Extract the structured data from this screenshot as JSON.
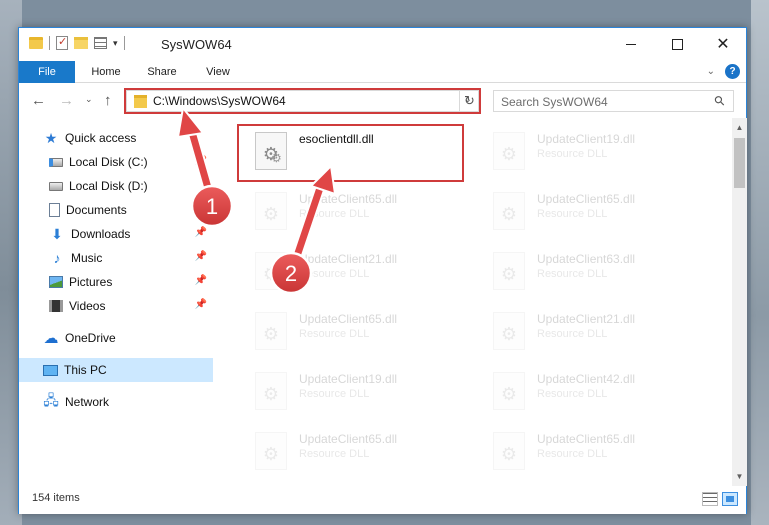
{
  "window": {
    "title": "SysWOW64",
    "controls": {
      "minimize": "minimize",
      "maximize": "maximize",
      "close": "✕"
    }
  },
  "ribbon": {
    "tabs": [
      "File",
      "Home",
      "Share",
      "View"
    ]
  },
  "address": {
    "path": "C:\\Windows\\SysWOW64",
    "search_placeholder": "Search SysWOW64"
  },
  "nav_pane": {
    "items": [
      {
        "label": "Quick access",
        "icon": "star-icon",
        "pinned": false
      },
      {
        "label": "Local Disk (C:)",
        "icon": "drive-icon",
        "pinned": true
      },
      {
        "label": "Local Disk (D:)",
        "icon": "drive-icon",
        "pinned": false
      },
      {
        "label": "Documents",
        "icon": "documents-icon",
        "pinned": true
      },
      {
        "label": "Downloads",
        "icon": "downloads-icon",
        "pinned": true
      },
      {
        "label": "Music",
        "icon": "music-icon",
        "pinned": true
      },
      {
        "label": "Pictures",
        "icon": "pictures-icon",
        "pinned": true
      },
      {
        "label": "Videos",
        "icon": "videos-icon",
        "pinned": true
      },
      {
        "label": "OneDrive",
        "icon": "cloud-icon",
        "pinned": false
      },
      {
        "label": "This PC",
        "icon": "computer-icon",
        "pinned": false,
        "selected": true
      },
      {
        "label": "Network",
        "icon": "network-icon",
        "pinned": false
      }
    ]
  },
  "files": [
    {
      "name": "esoclientdll.dll",
      "type": "",
      "highlighted": true
    },
    {
      "name": "UpdateClient19.dll",
      "type": "Resource DLL"
    },
    {
      "name": "UpdateClient65.dll",
      "type": "Resource DLL"
    },
    {
      "name": "UpdateClient65.dll",
      "type": "Resource DLL"
    },
    {
      "name": "UpdateClient21.dll",
      "type": "Resource DLL"
    },
    {
      "name": "UpdateClient63.dll",
      "type": "Resource DLL"
    },
    {
      "name": "UpdateClient65.dll",
      "type": "Resource DLL"
    },
    {
      "name": "UpdateClient21.dll",
      "type": "Resource DLL"
    },
    {
      "name": "UpdateClient19.dll",
      "type": "Resource DLL"
    },
    {
      "name": "UpdateClient42.dll",
      "type": "Resource DLL"
    },
    {
      "name": "UpdateClient65.dll",
      "type": "Resource DLL"
    },
    {
      "name": "UpdateClient65.dll",
      "type": "Resource DLL"
    }
  ],
  "status": {
    "item_count": "154 items"
  },
  "callouts": [
    {
      "number": "1"
    },
    {
      "number": "2"
    }
  ],
  "colors": {
    "accent": "#1979ca",
    "highlight_box": "#cf3b3b",
    "callout_fill": "#e04646",
    "selection": "#cce8ff"
  }
}
